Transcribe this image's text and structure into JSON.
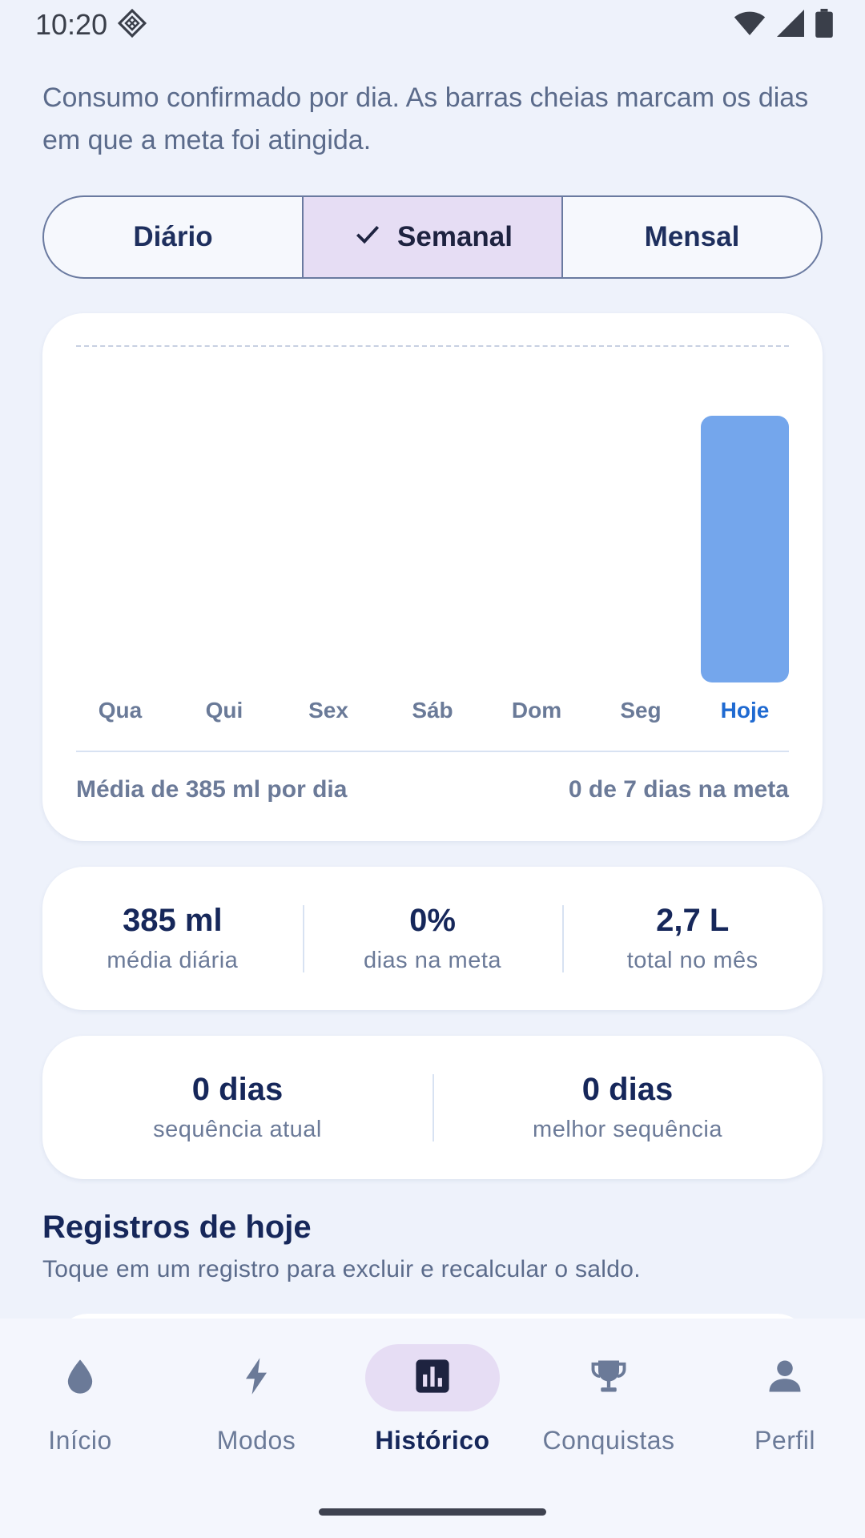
{
  "status_bar": {
    "time": "10:20",
    "icons": [
      "app-notification-icon",
      "wifi-icon",
      "signal-icon",
      "battery-icon"
    ]
  },
  "intro": "Consumo confirmado por dia. As barras cheias marcam os dias em que a meta foi atingida.",
  "period_tabs": {
    "items": [
      "Diário",
      "Semanal",
      "Mensal"
    ],
    "selected": "Semanal"
  },
  "chart": {
    "footer_left": "Média de 385 ml por dia",
    "footer_right": "0 de 7 dias na meta"
  },
  "chart_data": {
    "type": "bar",
    "categories": [
      "Qua",
      "Qui",
      "Sex",
      "Sáb",
      "Dom",
      "Seg",
      "Hoje"
    ],
    "values": [
      0,
      0,
      0,
      0,
      0,
      0,
      0.79
    ],
    "ylim": [
      0,
      1
    ],
    "goal_line": 1,
    "highlight_category": "Hoje",
    "colors": {
      "bar": "#74a6ec",
      "today_label": "#1f6ad1"
    }
  },
  "stats": [
    {
      "value": "385 ml",
      "label": "média diária"
    },
    {
      "value": "0%",
      "label": "dias na meta"
    },
    {
      "value": "2,7 L",
      "label": "total no mês"
    }
  ],
  "streaks": [
    {
      "value": "0 dias",
      "label": "sequência atual"
    },
    {
      "value": "0 dias",
      "label": "melhor sequência"
    }
  ],
  "section": {
    "title": "Registros de hoje",
    "subtitle": "Toque em um registro para excluir e recalcular o saldo."
  },
  "nav": {
    "items": [
      {
        "label": "Início",
        "icon": "drop-icon"
      },
      {
        "label": "Modos",
        "icon": "bolt-icon"
      },
      {
        "label": "Histórico",
        "icon": "bar-chart-icon"
      },
      {
        "label": "Conquistas",
        "icon": "trophy-icon"
      },
      {
        "label": "Perfil",
        "icon": "person-icon"
      }
    ],
    "active": "Histórico"
  },
  "colors": {
    "background": "#eef2fb",
    "accent_selected": "#e6ddf4",
    "primary_text": "#16275a"
  }
}
